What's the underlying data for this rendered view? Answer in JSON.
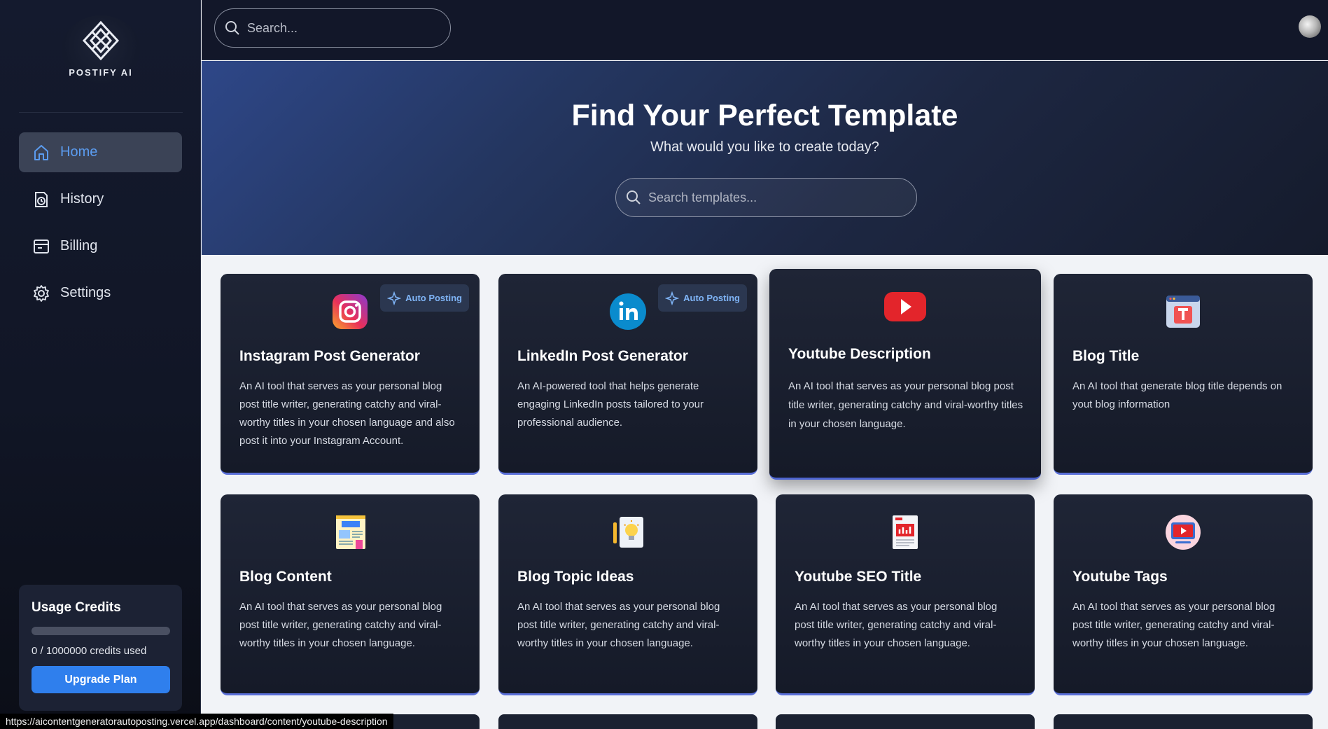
{
  "app": {
    "logo_text": "POSTIFY AI"
  },
  "sidebar": {
    "items": [
      {
        "label": "Home",
        "icon": "home-icon",
        "active": true
      },
      {
        "label": "History",
        "icon": "history-icon"
      },
      {
        "label": "Billing",
        "icon": "billing-icon"
      },
      {
        "label": "Settings",
        "icon": "settings-icon"
      }
    ],
    "credits": {
      "title": "Usage Credits",
      "used": 0,
      "total": 1000000,
      "text": "0 / 1000000 credits used",
      "upgrade_label": "Upgrade Plan"
    }
  },
  "topbar": {
    "search_placeholder": "Search..."
  },
  "hero": {
    "title": "Find Your Perfect Template",
    "subtitle": "What would you like to create today?",
    "search_placeholder": "Search templates..."
  },
  "templates": [
    {
      "title": "Instagram Post Generator",
      "desc": "An AI tool that serves as your personal blog post title writer, generating catchy and viral-worthy titles in your chosen language and also post it into your Instagram Account.",
      "badge": "Auto Posting",
      "icon": "instagram-icon"
    },
    {
      "title": "LinkedIn Post Generator",
      "desc": "An AI-powered tool that helps generate engaging LinkedIn posts tailored to your professional audience.",
      "badge": "Auto Posting",
      "icon": "linkedin-icon"
    },
    {
      "title": "Youtube Description",
      "desc": "An AI tool that serves as your personal blog post title writer, generating catchy and viral-worthy titles in your chosen language.",
      "icon": "youtube-icon"
    },
    {
      "title": "Blog Title",
      "desc": "An AI tool that generate blog title depends on yout blog information",
      "icon": "blog-title-icon"
    },
    {
      "title": "Blog Content",
      "desc": "An AI tool that serves as your personal blog post title writer, generating catchy and viral-worthy titles in your chosen language.",
      "icon": "blog-content-icon"
    },
    {
      "title": "Blog Topic Ideas",
      "desc": "An AI tool that serves as your personal blog post title writer, generating catchy and viral-worthy titles in your chosen language.",
      "icon": "idea-icon"
    },
    {
      "title": "Youtube SEO Title",
      "desc": "An AI tool that serves as your personal blog post title writer, generating catchy and viral-worthy titles in your chosen language.",
      "icon": "seo-report-icon"
    },
    {
      "title": "Youtube Tags",
      "desc": "An AI tool that serves as your personal blog post title writer, generating catchy and viral-worthy titles in your chosen language.",
      "icon": "video-tag-icon"
    }
  ],
  "status_bar": {
    "url": "https://aicontentgeneratorautoposting.vercel.app/dashboard/content/youtube-description"
  },
  "colors": {
    "accent": "#2f7fed",
    "active_nav_text": "#5b9cf0",
    "badge_text": "#7fb4f6"
  }
}
